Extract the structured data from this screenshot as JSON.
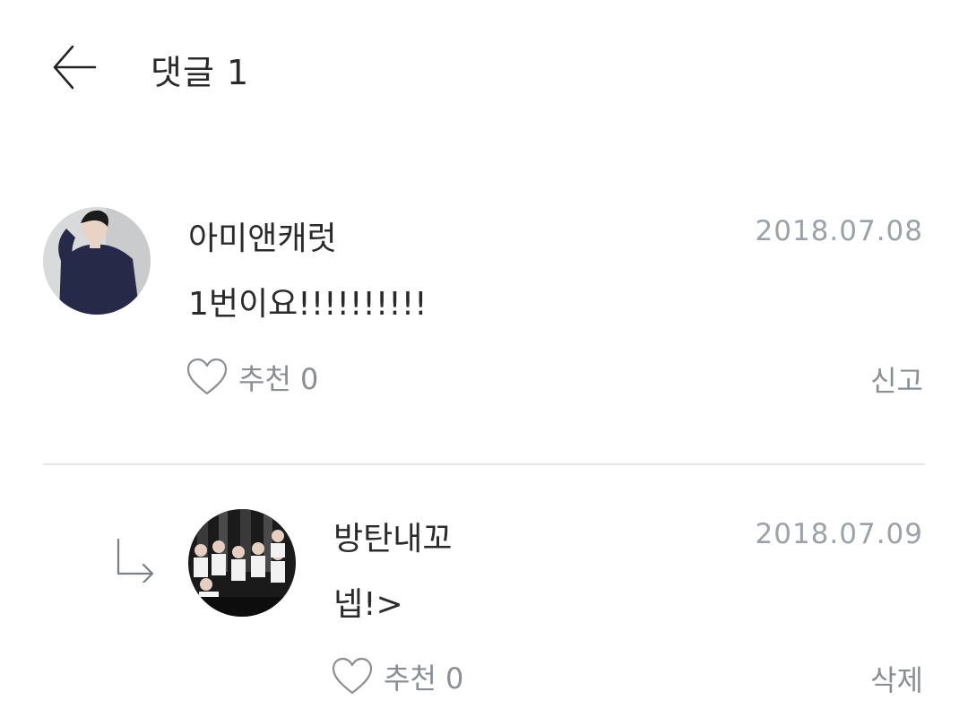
{
  "header": {
    "title": "댓글 1"
  },
  "comments": [
    {
      "username": "아미앤캐럿",
      "date": "2018.07.08",
      "text": "1번이요!!!!!!!!!!",
      "like_label": "추천 0",
      "action_label": "신고"
    }
  ],
  "replies": [
    {
      "username": "방탄내꼬",
      "date": "2018.07.09",
      "text": "넵!>",
      "like_label": "추천 0",
      "action_label": "삭제"
    }
  ],
  "colors": {
    "text": "#2a2a2a",
    "date": "#9ba2a9",
    "secondary": "#8a8f94",
    "divider": "#e6e6e6"
  }
}
